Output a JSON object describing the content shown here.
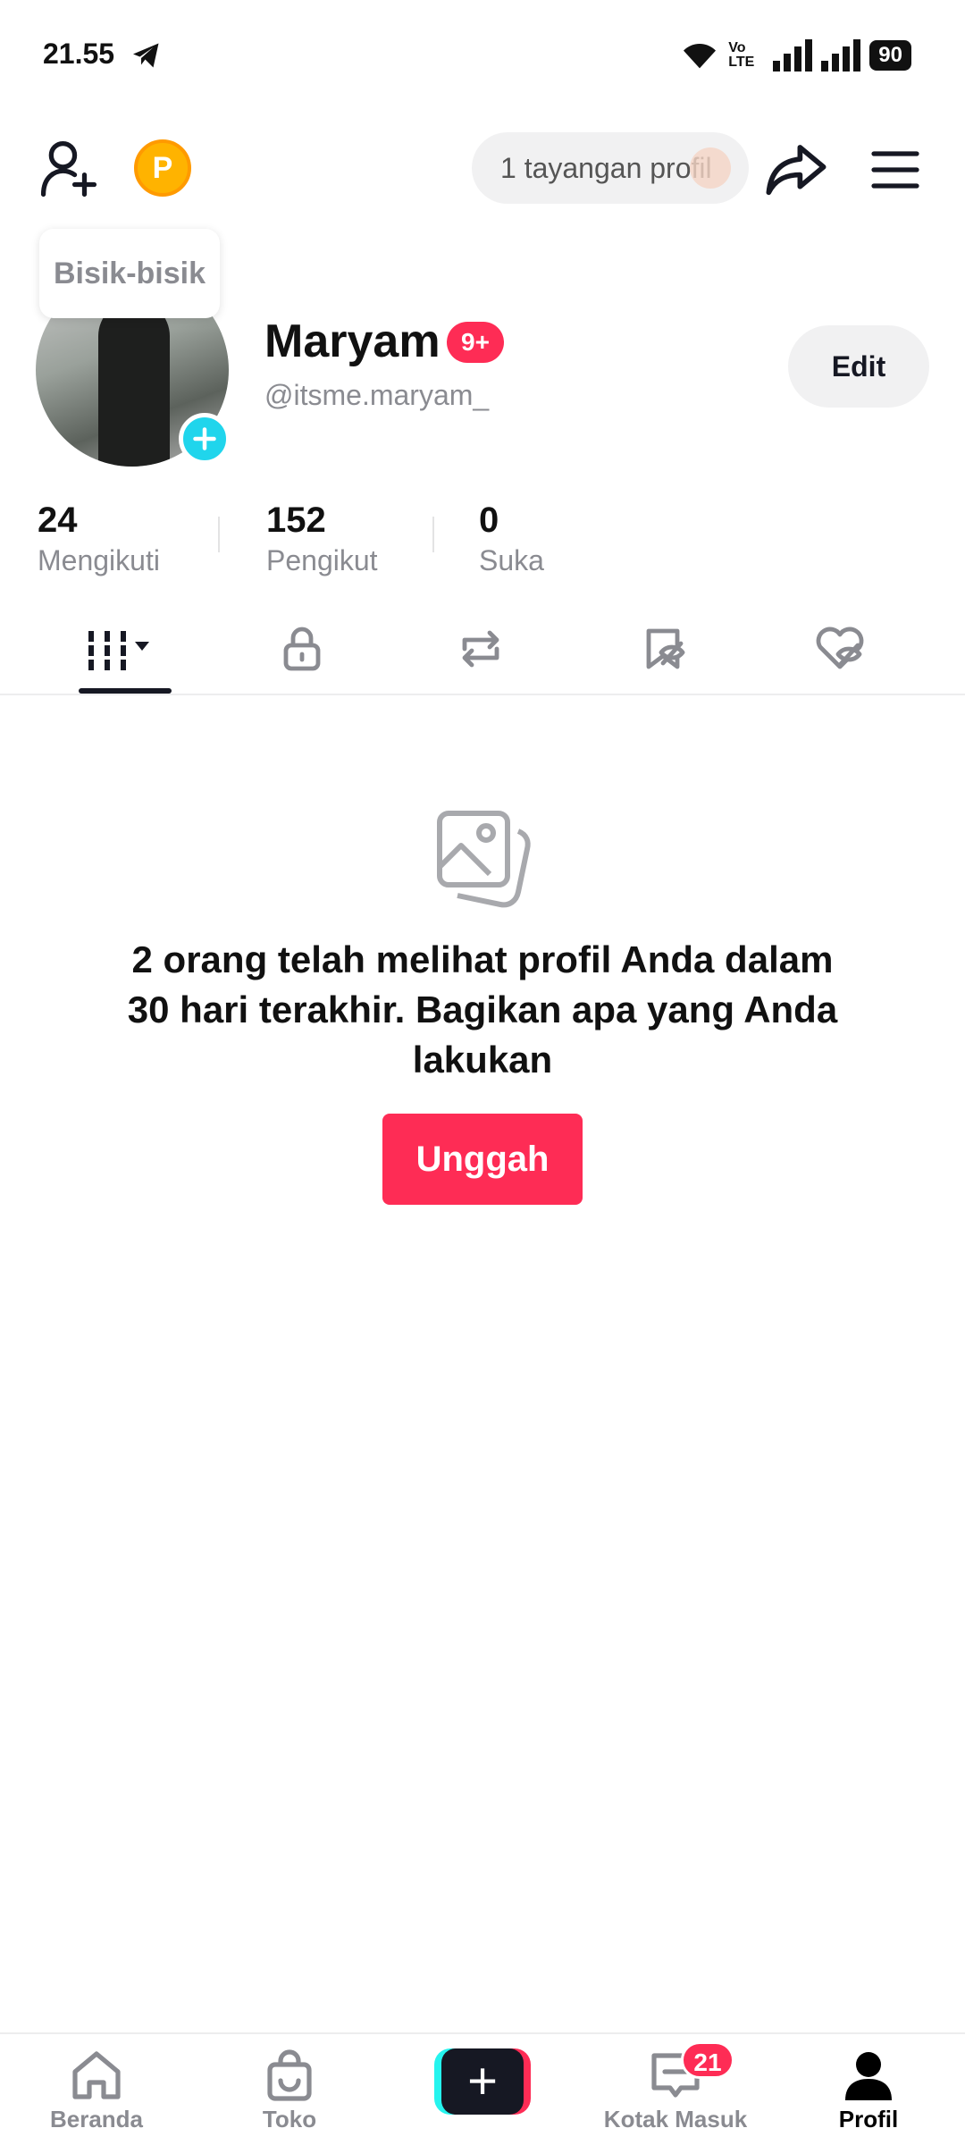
{
  "status_bar": {
    "time": "21.55",
    "network": "Vo LTE",
    "battery": "90"
  },
  "top_bar": {
    "profile_views": "1 tayangan profil"
  },
  "tooltip": {
    "whisper": "Bisik-bisik"
  },
  "profile": {
    "display_name": "Maryam",
    "notification_badge": "9+",
    "username": "@itsme.maryam_",
    "edit_label": "Edit",
    "coin_letter": "P"
  },
  "stats": [
    {
      "value": "24",
      "label": "Mengikuti"
    },
    {
      "value": "152",
      "label": "Pengikut"
    },
    {
      "value": "0",
      "label": "Suka"
    }
  ],
  "tabs": [
    {
      "icon": "videos-grid-icon",
      "active": true
    },
    {
      "icon": "lock-icon",
      "active": false
    },
    {
      "icon": "repost-icon",
      "active": false
    },
    {
      "icon": "favorites-icon",
      "active": false
    },
    {
      "icon": "liked-icon",
      "active": false
    }
  ],
  "empty_state": {
    "message": "2 orang telah melihat profil Anda dalam 30 hari terakhir. Bagikan apa yang Anda lakukan",
    "upload_label": "Unggah"
  },
  "bottom_nav": {
    "home": "Beranda",
    "shop": "Toko",
    "create": "+",
    "inbox": "Kotak Masuk",
    "inbox_badge": "21",
    "profile": "Profil"
  },
  "colors": {
    "accent": "#fe2c55",
    "cyan": "#25f4ee",
    "text": "#161823",
    "muted": "#8a8b91"
  }
}
